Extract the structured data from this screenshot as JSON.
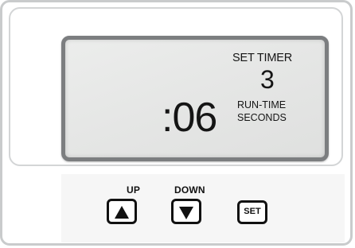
{
  "display": {
    "mode_label": "SET TIMER",
    "timer_number": "3",
    "runtime_value": ":06",
    "unit_line1": "RUN-TIME",
    "unit_line2": "SECONDS"
  },
  "controls": {
    "up_label": "UP",
    "down_label": "DOWN",
    "set_label": "SET"
  },
  "icons": {
    "up": "triangle-up-icon",
    "down": "triangle-down-icon"
  },
  "colors": {
    "lcd_background": "#e6e7e6",
    "lcd_border": "#7c7e80",
    "text": "#151515",
    "device_border": "#c9cbcc"
  }
}
